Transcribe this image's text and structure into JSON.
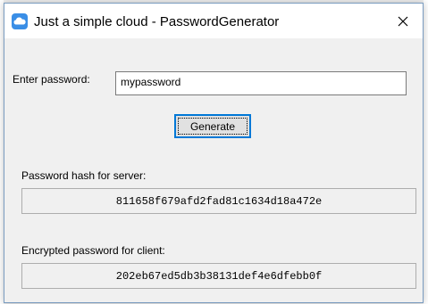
{
  "window": {
    "title": "Just a simple cloud - PasswordGenerator",
    "icon": "cloud-icon",
    "close_icon": "close-icon",
    "accent": "#0078d7"
  },
  "form": {
    "password_label": "Enter password:",
    "password_value": "mypassword",
    "generate_label": "Generate"
  },
  "results": {
    "server_hash_label": "Password hash for server:",
    "server_hash_value": "811658f679afd2fad81c1634d18a472e",
    "client_encrypted_label": "Encrypted password for client:",
    "client_encrypted_value": "202eb67ed5db3b38131def4e6dfebb0f"
  }
}
